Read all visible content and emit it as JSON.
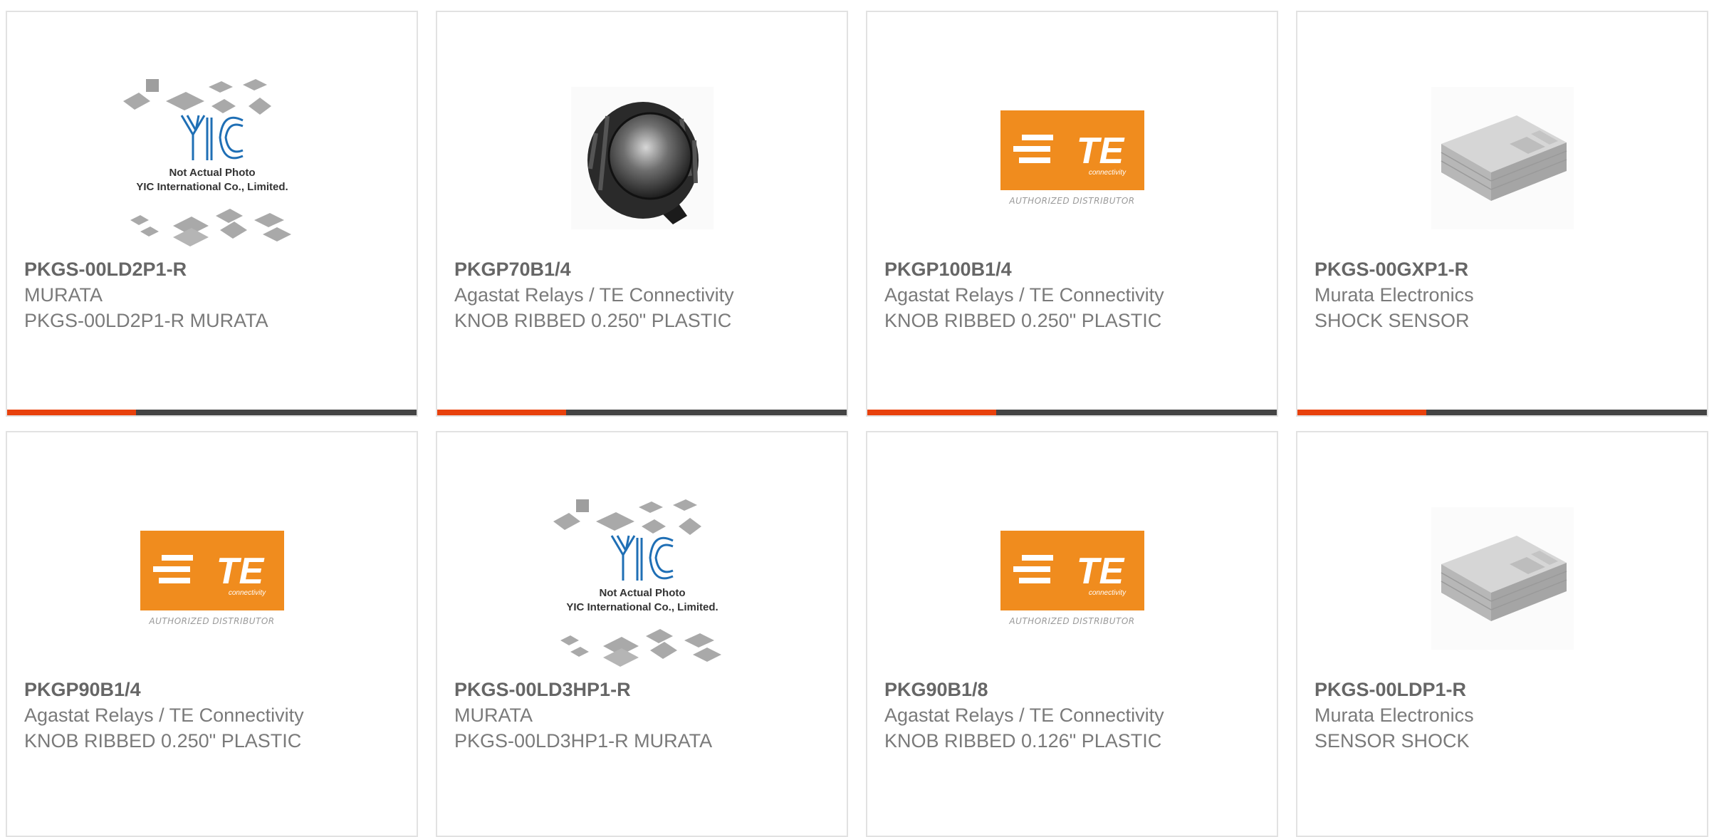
{
  "products": [
    {
      "part_number": "PKGS-00LD2P1-R",
      "manufacturer": "MURATA",
      "description": "PKGS-00LD2P1-R MURATA",
      "image": "yic-placeholder",
      "image_text": [
        "Not Actual Photo",
        "YIC International Co., Limited."
      ]
    },
    {
      "part_number": "PKGP70B1/4",
      "manufacturer": "Agastat Relays / TE Connectivity",
      "description": "KNOB RIBBED 0.250\" PLASTIC",
      "image": "knob-photo"
    },
    {
      "part_number": "PKGP100B1/4",
      "manufacturer": "Agastat Relays / TE Connectivity",
      "description": "KNOB RIBBED 0.250\" PLASTIC",
      "image": "te-logo",
      "image_text": [
        "AUTHORIZED DISTRIBUTOR"
      ]
    },
    {
      "part_number": "PKGS-00GXP1-R",
      "manufacturer": "Murata Electronics",
      "description": "SHOCK SENSOR",
      "image": "sensor-chip"
    },
    {
      "part_number": "PKGP90B1/4",
      "manufacturer": "Agastat Relays / TE Connectivity",
      "description": "KNOB RIBBED 0.250\" PLASTIC",
      "image": "te-logo",
      "image_text": [
        "AUTHORIZED DISTRIBUTOR"
      ]
    },
    {
      "part_number": "PKGS-00LD3HP1-R",
      "manufacturer": "MURATA",
      "description": "PKGS-00LD3HP1-R MURATA",
      "image": "yic-placeholder",
      "image_text": [
        "Not Actual Photo",
        "YIC International Co., Limited."
      ]
    },
    {
      "part_number": "PKG90B1/8",
      "manufacturer": "Agastat Relays / TE Connectivity",
      "description": "KNOB RIBBED 0.126\" PLASTIC",
      "image": "te-logo",
      "image_text": [
        "AUTHORIZED DISTRIBUTOR"
      ]
    },
    {
      "part_number": "PKGS-00LDP1-R",
      "manufacturer": "Murata Electronics",
      "description": "SENSOR SHOCK",
      "image": "sensor-chip"
    }
  ],
  "colors": {
    "accent_red": "#e8410c",
    "accent_dark": "#444444",
    "te_orange": "#f08c1e",
    "yic_blue": "#1f6fb5"
  }
}
